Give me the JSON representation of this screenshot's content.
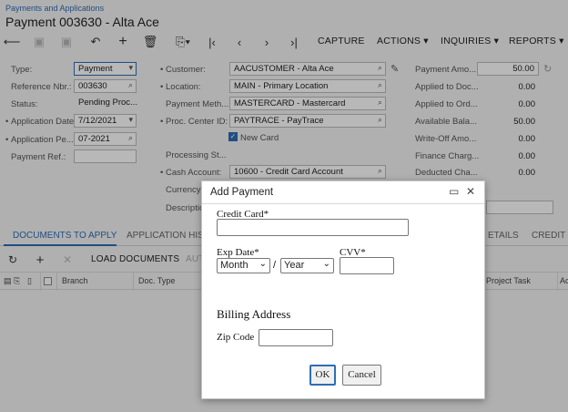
{
  "breadcrumb": "Payments and Applications",
  "title": "Payment 003630 - Alta Ace",
  "toolbar": {
    "capture": "CAPTURE",
    "actions": "ACTIONS",
    "inquiries": "INQUIRIES",
    "reports": "REPORTS"
  },
  "form_left": {
    "type_label": "Type:",
    "type_value": "Payment",
    "ref_label": "Reference Nbr.:",
    "ref_value": "003630",
    "status_label": "Status:",
    "status_value": "Pending Proc...",
    "appdate_label": "Application Date:",
    "appdate_value": "7/12/2021",
    "appperiod_label": "Application Pe...",
    "appperiod_value": "07-2021",
    "payref_label": "Payment Ref.:",
    "payref_value": ""
  },
  "form_mid": {
    "customer_label": "Customer:",
    "customer_value": "AACUSTOMER - Alta Ace",
    "location_label": "Location:",
    "location_value": "MAIN - Primary Location",
    "paymeth_label": "Payment Meth...",
    "paymeth_value": "MASTERCARD - Mastercard",
    "proccenter_label": "Proc. Center ID:",
    "proccenter_value": "PAYTRACE - PayTrace",
    "newcard_label": "New Card",
    "processing_label": "Processing St...",
    "cashaccount_label": "Cash Account:",
    "cashaccount_value": "10600 - Credit Card Account",
    "currency_label": "Currency:",
    "description_label": "Descriptio..."
  },
  "form_right": {
    "payamount_label": "Payment Amo...",
    "payamount_value": "50.00",
    "applied_doc_label": "Applied to Doc...",
    "applied_doc_value": "0.00",
    "applied_ord_label": "Applied to Ord...",
    "applied_ord_value": "0.00",
    "available_label": "Available Bala...",
    "available_value": "50.00",
    "writeoff_label": "Write-Off Amo...",
    "writeoff_value": "0.00",
    "finance_label": "Finance Charg...",
    "finance_value": "0.00",
    "deducted_label": "Deducted Cha...",
    "deducted_value": "0.00"
  },
  "tabs": {
    "documents": "DOCUMENTS TO APPLY",
    "history": "APPLICATION HISTO...",
    "details": "ETAILS",
    "credit": "CREDIT C"
  },
  "grid": {
    "load_documents": "LOAD DOCUMENTS",
    "auto": "AUT",
    "col_branch": "Branch",
    "col_doctype": "Doc. Type",
    "col_projecttask": "Project Task",
    "col_ac": "Ac"
  },
  "dialog": {
    "title": "Add Payment",
    "credit_card_label": "Credit Card*",
    "exp_date_label": "Exp Date*",
    "cvv_label": "CVV*",
    "month_option": "Month",
    "year_option": "Year",
    "date_separator": "/",
    "billing_heading": "Billing Address",
    "zip_label": "Zip Code",
    "ok_label": "OK",
    "cancel_label": "Cancel"
  }
}
